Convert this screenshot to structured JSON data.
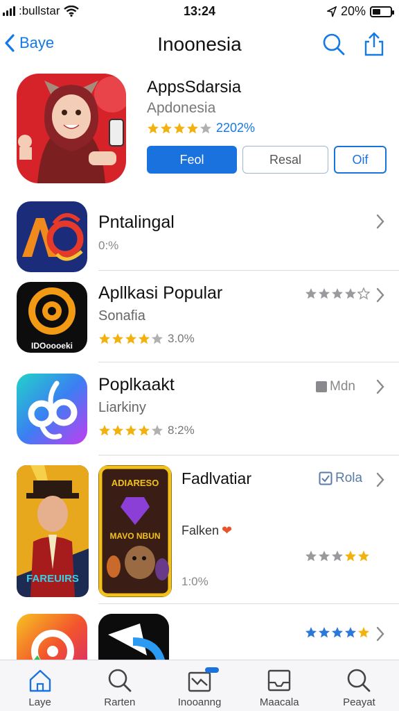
{
  "status_bar": {
    "carrier": ":bullstar",
    "time": "13:24",
    "battery": "20%"
  },
  "nav": {
    "back_label": "Baye",
    "title": "Inoonesia"
  },
  "featured": {
    "name": "AppsSdarsia",
    "subtitle": "Apdonesia",
    "rating_text": "2202%",
    "stars": 4,
    "buttons": [
      "Feol",
      "Resal",
      "Oif"
    ]
  },
  "rows": [
    {
      "title": "Pntalingal",
      "sub": "0:%"
    },
    {
      "title": "Apllkasi Popular",
      "sub": "Sonafia",
      "rating_text": "3.0%",
      "stars": 4,
      "right_stars": 4
    },
    {
      "title": "Poplkaakt",
      "sub": "Liarkiny",
      "rating_text": "8:2%",
      "stars": 4,
      "right_label": "Mdn"
    },
    {
      "title": "Fadlvatiar",
      "right_label": "Rola",
      "note": "Falken",
      "pct": "1:0%",
      "right_stars": 5,
      "poster_text": "MAVO NBUN",
      "poster_title": "ADIARESO",
      "poster_left": "FAREUIRS"
    },
    {
      "right_stars": 4
    }
  ],
  "icon_texts": {
    "row2": "IDOoooeki"
  },
  "tabs": [
    {
      "label": "Laye",
      "icon": "home-icon"
    },
    {
      "label": "Rarten",
      "icon": "search-icon"
    },
    {
      "label": "Inooanng",
      "icon": "inbox-icon"
    },
    {
      "label": "Maacala",
      "icon": "tray-icon"
    },
    {
      "label": "Peayat",
      "icon": "search-icon"
    }
  ],
  "colors": {
    "accent": "#1a72de",
    "star": "#f2b10e",
    "star_grey": "#b0b0b0"
  }
}
